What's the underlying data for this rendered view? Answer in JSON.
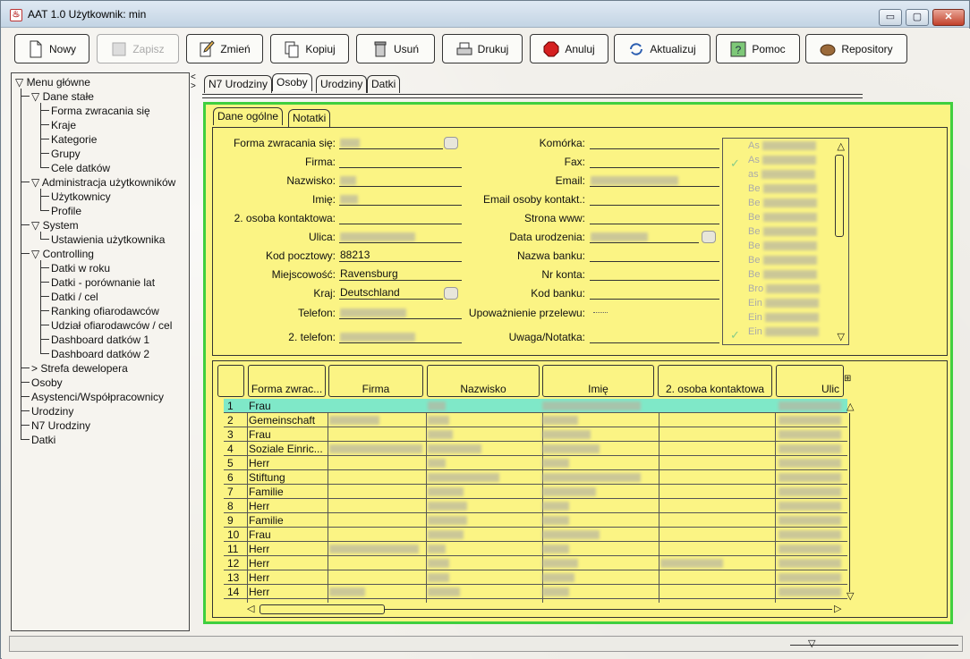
{
  "window": {
    "title": "AAT 1.0  Użytkownik: min",
    "controls": {
      "minimize": "▭",
      "maximize": "▢",
      "close": "✕"
    }
  },
  "toolbar": {
    "buttons": [
      {
        "label": "Nowy",
        "icon": "new-document-icon"
      },
      {
        "label": "Zapisz",
        "icon": "save-icon",
        "disabled": true
      },
      {
        "label": "Zmień",
        "icon": "edit-pencil-icon"
      },
      {
        "label": "Kopiuj",
        "icon": "copy-icon"
      },
      {
        "label": "Usuń",
        "icon": "trash-icon"
      },
      {
        "label": "Drukuj",
        "icon": "printer-icon"
      },
      {
        "label": "Anuluj",
        "icon": "stop-icon"
      },
      {
        "label": "Aktualizuj",
        "icon": "refresh-icon"
      },
      {
        "label": "Pomoc",
        "icon": "help-icon"
      },
      {
        "label": "Repository",
        "icon": "repository-icon"
      }
    ]
  },
  "tree": {
    "root": "Menu główne",
    "dane_stale": "Dane stałe",
    "dane_stale_items": [
      "Forma zwracania się",
      "Kraje",
      "Kategorie",
      "Grupy",
      "Cele datków"
    ],
    "admin": "Administracja użytkowników",
    "admin_items": [
      "Użytkownicy",
      "Profile"
    ],
    "system": "System",
    "system_items": [
      "Ustawienia użytkownika"
    ],
    "controlling": "Controlling",
    "controlling_items": [
      "Datki w roku",
      "Datki - porównanie lat",
      "Datki / cel",
      "Ranking ofiarodawców",
      "Udział ofiarodawców / cel",
      "Dashboard datków 1",
      "Dashboard datków 2"
    ],
    "strefa": "Strefa dewelopera",
    "top_items": [
      "Osoby",
      "Asystenci/Współpracownicy",
      "Urodziny",
      "N7 Urodziny",
      "Datki"
    ]
  },
  "tabs": {
    "main": [
      "N7 Urodziny",
      "Osoby",
      "Urodziny",
      "Datki"
    ],
    "sub": [
      "Dane ogólne",
      "Notatki"
    ]
  },
  "form": {
    "left_labels": [
      "Forma zwracania się:",
      "Firma:",
      "Nazwisko:",
      "Imię:",
      "2. osoba kontaktowa:",
      "Ulica:",
      "Kod pocztowy:",
      "Miejscowość:",
      "Kraj:",
      "Telefon:",
      "2. telefon:"
    ],
    "right_labels": [
      "Komórka:",
      "Fax:",
      "Email:",
      "Email osoby kontakt.:",
      "Strona www:",
      "Data urodzenia:",
      "Nazwa banku:",
      "Nr konta:",
      "Kod banku:",
      "Upoważnienie przelewu:",
      "Uwaga/Notatka:"
    ],
    "values": {
      "kod_pocztowy": "88213",
      "miejscowosc": "Ravensburg",
      "kraj": "Deutschland"
    },
    "list_prefixes": [
      "As",
      "As",
      "as",
      "Be",
      "Be",
      "Be",
      "Be",
      "Be",
      "Be",
      "Be",
      "Bro",
      "Ein",
      "Ein",
      "Ein"
    ]
  },
  "grid": {
    "headers": [
      "Forma zwrac...",
      "Firma",
      "Nazwisko",
      "Imię",
      "2. osoba kontaktowa",
      "Ulic"
    ],
    "rows": [
      [
        "1",
        "Frau"
      ],
      [
        "2",
        "Gemeinschaft"
      ],
      [
        "3",
        "Frau"
      ],
      [
        "4",
        "Soziale Einric..."
      ],
      [
        "5",
        "Herr"
      ],
      [
        "6",
        "Stiftung"
      ],
      [
        "7",
        "Familie"
      ],
      [
        "8",
        "Herr"
      ],
      [
        "9",
        "Familie"
      ],
      [
        "10",
        "Frau"
      ],
      [
        "11",
        "Herr"
      ],
      [
        "12",
        "Herr"
      ],
      [
        "13",
        "Herr"
      ],
      [
        "14",
        "Herr"
      ]
    ]
  },
  "colors": {
    "panel": "#fbf484",
    "border_green": "#3fcf3f",
    "selection": "#7fe8c8"
  }
}
